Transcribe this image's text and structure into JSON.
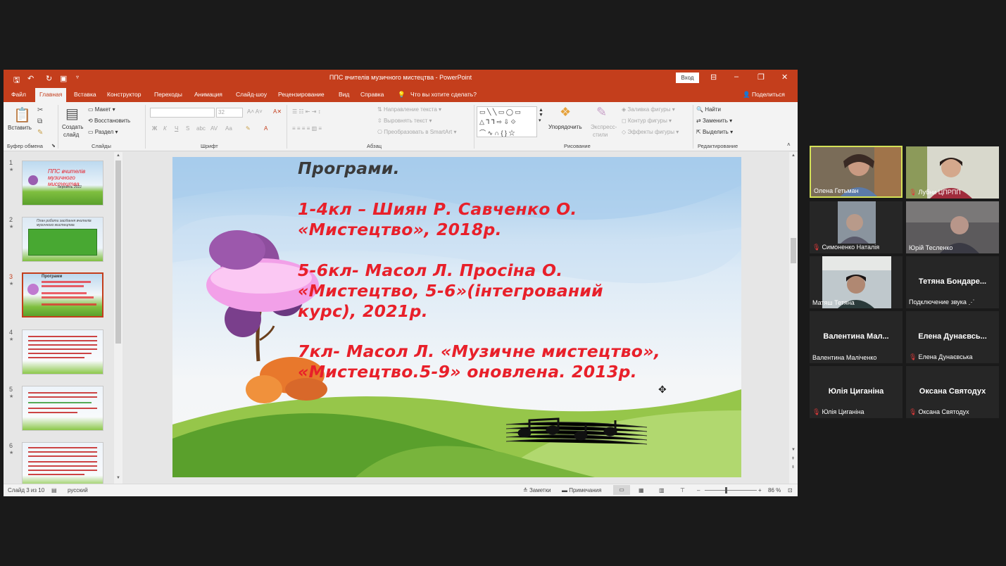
{
  "window": {
    "title": "ППС вчителів музичного мистецтва  -  PowerPoint",
    "login_button": "Вход",
    "share": "Поделиться"
  },
  "tabs": [
    "Файл",
    "Главная",
    "Вставка",
    "Конструктор",
    "Переходы",
    "Анимация",
    "Слайд-шоу",
    "Рецензирование",
    "Вид",
    "Справка"
  ],
  "tell_me": "Что вы хотите сделать?",
  "ribbon": {
    "paste": "Вставить",
    "clipboard": "Буфер обмена",
    "new_slide_1": "Создать",
    "new_slide_2": "слайд",
    "layout": "Макет",
    "reset": "Восстановить",
    "section": "Раздел",
    "slides": "Слайды",
    "font_group": "Шрифт",
    "font_size": "32",
    "paragraph": "Абзац",
    "text_direction": "Направление текста",
    "align_text": "Выровнять текст",
    "smartart": "Преобразовать в SmartArt",
    "arrange": "Упорядочить",
    "quick_styles_1": "Экспресс-",
    "quick_styles_2": "стили",
    "shape_fill": "Заливка фигуры",
    "shape_outline": "Контур фигуры",
    "shape_effects": "Эффекты фигуры",
    "drawing": "Рисование",
    "find": "Найти",
    "replace": "Заменить",
    "select": "Выделить",
    "editing": "Редактирование"
  },
  "thumbnails": [
    {
      "num": "1",
      "title": "ППС вчителів музичного мистецтва",
      "sub": "березень 2022"
    },
    {
      "num": "2",
      "title": "План роботи засідання вчителів музичного мистецтва"
    },
    {
      "num": "3",
      "title": "Програми"
    },
    {
      "num": "4"
    },
    {
      "num": "5"
    },
    {
      "num": "6"
    }
  ],
  "slide": {
    "heading": "Програми.",
    "l1": "1-4кл – Шиян Р. Савченко О.",
    "l2": "«Мистецтво», 2018р.",
    "l3": "5-6кл- Масол Л. Просіна О.",
    "l4": "«Мистецтво, 5-6»(інтегрований",
    "l5": "курс), 2021р.",
    "l6": "7кл- Масол Л. «Музичне мистецтво»,",
    "l7": "«Мистецтво.5-9» оновлена. 2013р."
  },
  "status": {
    "slide_of": "Слайд 3 из 10",
    "language": "русский",
    "notes": "Заметки",
    "comments": "Примечания",
    "zoom": "86 %"
  },
  "participants": [
    {
      "label": "Олена Гетьман",
      "muted": false,
      "video": true,
      "active": true
    },
    {
      "label": "Лубни ЦПРПП",
      "muted": true,
      "video": true
    },
    {
      "label": "Симоненко Наталія",
      "muted": true,
      "video": true
    },
    {
      "label": "Юрій Тесленко",
      "muted": false,
      "video": true
    },
    {
      "label": "Матяш Тетяна",
      "muted": false,
      "video": true
    },
    {
      "label": "Подключение звука",
      "big": "Тетяна  Бондаре...",
      "muted": false,
      "video": false
    },
    {
      "label": "Валентина Маліченко",
      "big": "Валентина  Мал...",
      "muted": false,
      "video": false
    },
    {
      "label": "Елена Дунаєвська",
      "big": "Елена Дунаєвсь...",
      "muted": true,
      "video": false
    },
    {
      "label": "Юлія Циганіна",
      "big": "Юлія Циганіна",
      "muted": true,
      "video": false
    },
    {
      "label": "Оксана Святодух",
      "big": "Оксана Святодух",
      "muted": true,
      "video": false
    }
  ],
  "colors": {
    "accent": "#c43e1c",
    "slide_text": "#e8202a",
    "active_speaker": "#d4e157"
  }
}
